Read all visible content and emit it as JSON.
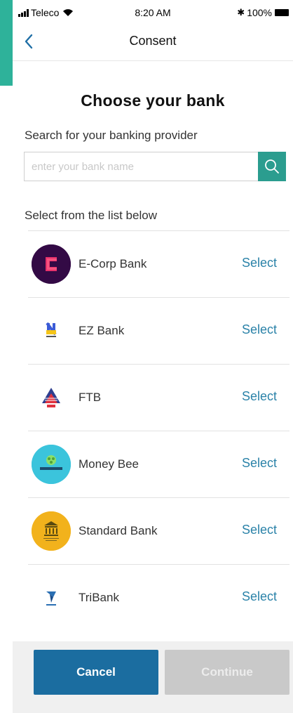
{
  "status_bar": {
    "carrier": "Teleco",
    "time": "8:20 AM",
    "battery": "100%"
  },
  "nav": {
    "title": "Consent",
    "back_icon": "chevron-left-icon"
  },
  "page": {
    "heading": "Choose your bank",
    "search_label": "Search for your banking provider",
    "search_placeholder": "enter your bank name",
    "search_value": "",
    "list_label": "Select from the list below"
  },
  "banks": [
    {
      "name": "E-Corp Bank",
      "action": "Select",
      "logo_color": "#3a0a4a"
    },
    {
      "name": "EZ Bank",
      "action": "Select",
      "logo_color": "#3b5bd6"
    },
    {
      "name": "FTB",
      "action": "Select",
      "logo_color": "#e0323f"
    },
    {
      "name": "Money Bee",
      "action": "Select",
      "logo_color": "#3bc4dc"
    },
    {
      "name": "Standard Bank",
      "action": "Select",
      "logo_color": "#f2b21c"
    },
    {
      "name": "TriBank",
      "action": "Select",
      "logo_color": "#2a6fb3"
    }
  ],
  "footer": {
    "cancel_label": "Cancel",
    "continue_label": "Continue"
  },
  "colors": {
    "accent": "#2b9d8f",
    "primary_button": "#1b6da0",
    "disabled_button": "#c9c9c9",
    "link": "#2a82a8"
  }
}
